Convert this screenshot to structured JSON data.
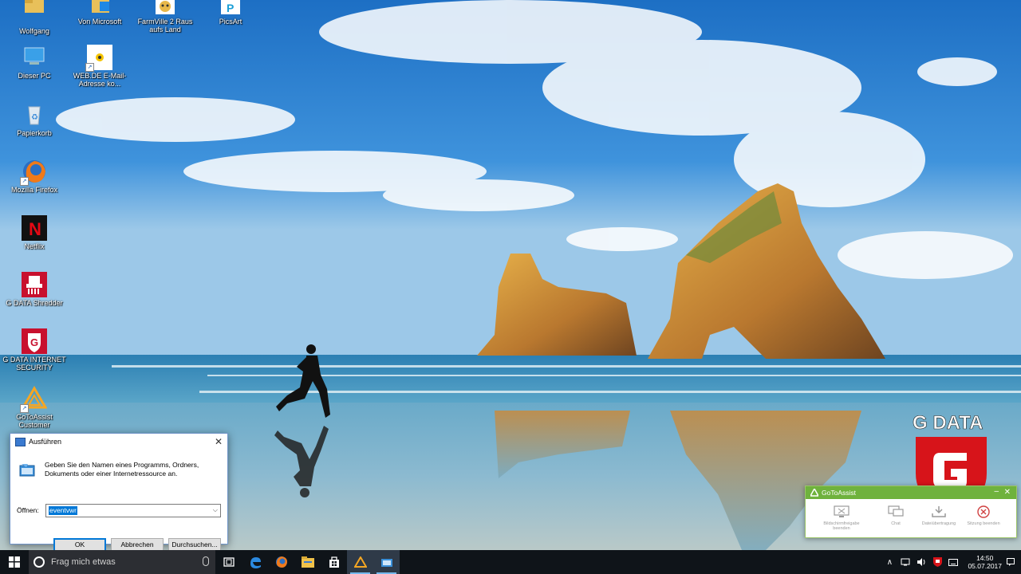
{
  "desktop": {
    "icons": [
      {
        "label": "Wolfgang",
        "icon": "user-folder-icon"
      },
      {
        "label": "Von Microsoft",
        "icon": "store-folder-icon"
      },
      {
        "label": "FarmVille 2 Raus aufs Land",
        "icon": "farmville-icon"
      },
      {
        "label": "PicsArt",
        "icon": "picsart-icon"
      },
      {
        "label": "Dieser PC",
        "icon": "computer-icon"
      },
      {
        "label": "WEB.DE E-Mail-Adresse ko...",
        "icon": "webde-icon"
      },
      {
        "label": "Papierkorb",
        "icon": "recycle-bin-icon"
      },
      {
        "label": "Mozilla Firefox",
        "icon": "firefox-icon"
      },
      {
        "label": "Netflix",
        "icon": "netflix-icon"
      },
      {
        "label": "G DATA Shredder",
        "icon": "gdata-shredder-icon"
      },
      {
        "label": "G DATA INTERNET SECURITY",
        "icon": "gdata-security-icon"
      },
      {
        "label": "GoToAssist Customer",
        "icon": "gotoassist-icon"
      }
    ]
  },
  "run_dialog": {
    "title": "Ausführen",
    "description": "Geben Sie den Namen eines Programms, Ordners, Dokuments oder einer Internetressource an.",
    "open_label": "Öffnen:",
    "input_value": "eventvwr",
    "ok_label": "OK",
    "cancel_label": "Abbrechen",
    "browse_label": "Durchsuchen..."
  },
  "taskbar": {
    "search_placeholder": "Frag mich etwas",
    "clock_time": "14:50",
    "clock_date": "05.07.2017",
    "apps": [
      "task-view-icon",
      "edge-icon",
      "firefox-icon",
      "file-explorer-icon",
      "store-icon",
      "gotoassist-icon",
      "run-icon"
    ]
  },
  "gotoassist": {
    "title": "GoToAssist",
    "actions": [
      {
        "label": "Bildschirmfreigabe beenden",
        "icon": "screen-share-icon"
      },
      {
        "label": "Chat",
        "icon": "chat-icon"
      },
      {
        "label": "Dateiübertragung",
        "icon": "file-transfer-icon"
      },
      {
        "label": "Sitzung beenden",
        "icon": "end-session-icon"
      }
    ]
  },
  "gdata_logo": {
    "text": "G DATA"
  },
  "colors": {
    "accent": "#0078d7",
    "taskbar": "#0f1419",
    "gotoassist_green": "#6fb23d",
    "gdata_red": "#d7141a"
  }
}
